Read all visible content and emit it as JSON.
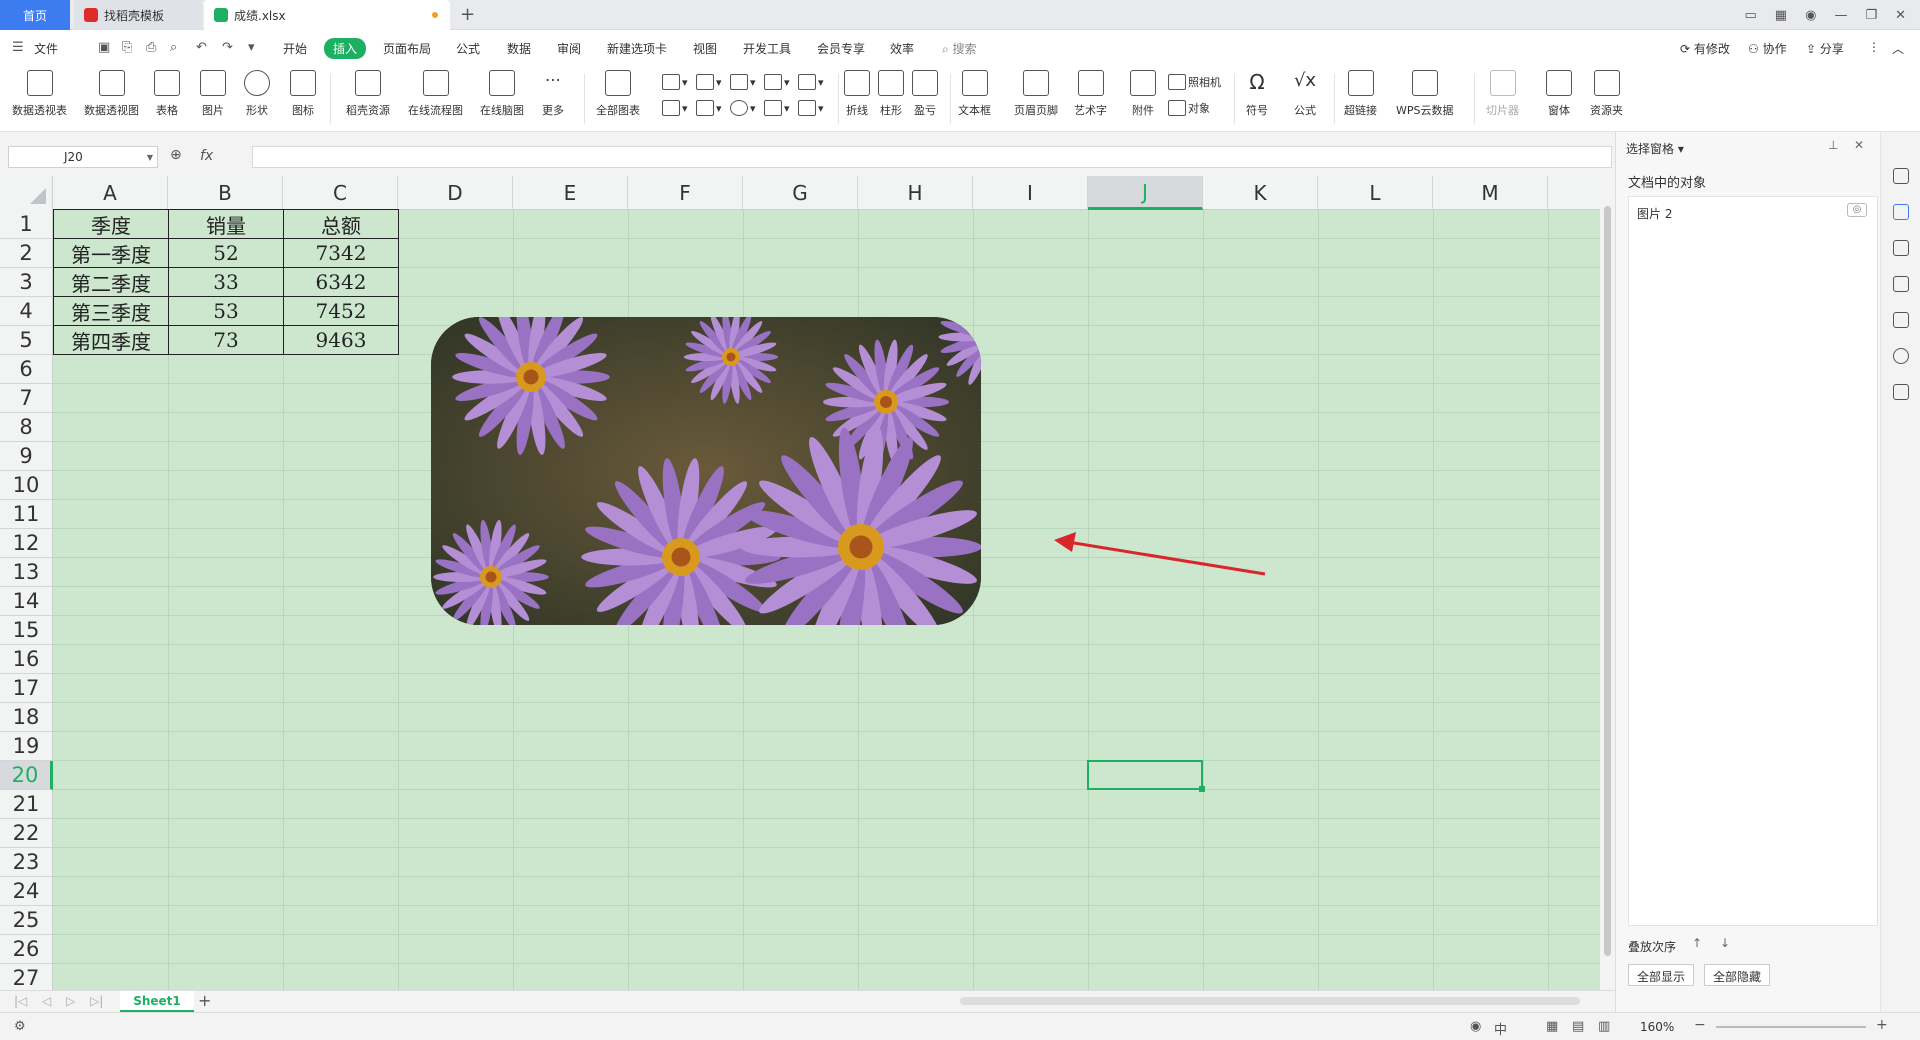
{
  "tabs": {
    "home": "首页",
    "template": "找稻壳模板",
    "file": "成绩.xlsx"
  },
  "menu": {
    "file": "文件",
    "items": [
      "开始",
      "插入",
      "页面布局",
      "公式",
      "数据",
      "审阅",
      "新建选项卡",
      "视图",
      "开发工具",
      "会员专享",
      "效率"
    ],
    "search": "搜索",
    "right": [
      "有修改",
      "协作",
      "分享"
    ]
  },
  "ribbon": {
    "items": [
      "数据透视表",
      "数据透视图",
      "表格",
      "图片",
      "形状",
      "图标",
      "稻壳资源",
      "在线流程图",
      "在线脑图",
      "更多",
      "全部图表",
      "折线",
      "柱形",
      "盈亏",
      "文本框",
      "页眉页脚",
      "艺术字",
      "附件",
      "对象",
      "照相机",
      "符号",
      "公式",
      "超链接",
      "WPS云数据",
      "切片器",
      "窗体",
      "资源夹"
    ]
  },
  "formula_bar": {
    "name_box": "J20",
    "fx": "fx",
    "value": ""
  },
  "sheet": {
    "columns": [
      "A",
      "B",
      "C",
      "D",
      "E",
      "F",
      "G",
      "H",
      "I",
      "J",
      "K",
      "L",
      "M"
    ],
    "rows": [
      "1",
      "2",
      "3",
      "4",
      "5",
      "6",
      "7",
      "8",
      "9",
      "10",
      "11",
      "12",
      "13",
      "14",
      "15",
      "16",
      "17",
      "18",
      "19",
      "20",
      "21",
      "22",
      "23",
      "24",
      "25",
      "26",
      "27"
    ],
    "table": [
      [
        "季度",
        "销量",
        "总额"
      ],
      [
        "第一季度",
        "52",
        "7342"
      ],
      [
        "第二季度",
        "33",
        "6342"
      ],
      [
        "第三季度",
        "53",
        "7452"
      ],
      [
        "第四季度",
        "73",
        "9463"
      ]
    ],
    "selected_cell": "J20",
    "tab": "Sheet1"
  },
  "panel": {
    "title": "选择窗格",
    "subtitle": "文档中的对象",
    "objects": [
      "图片 2"
    ],
    "stack_order": "叠放次序",
    "show_all": "全部显示",
    "hide_all": "全部隐藏"
  },
  "status": {
    "zoom": "160%"
  },
  "colors": {
    "accent": "#1eb062",
    "grid_bg": "#cde7cf",
    "arrow": "#d9262a"
  }
}
